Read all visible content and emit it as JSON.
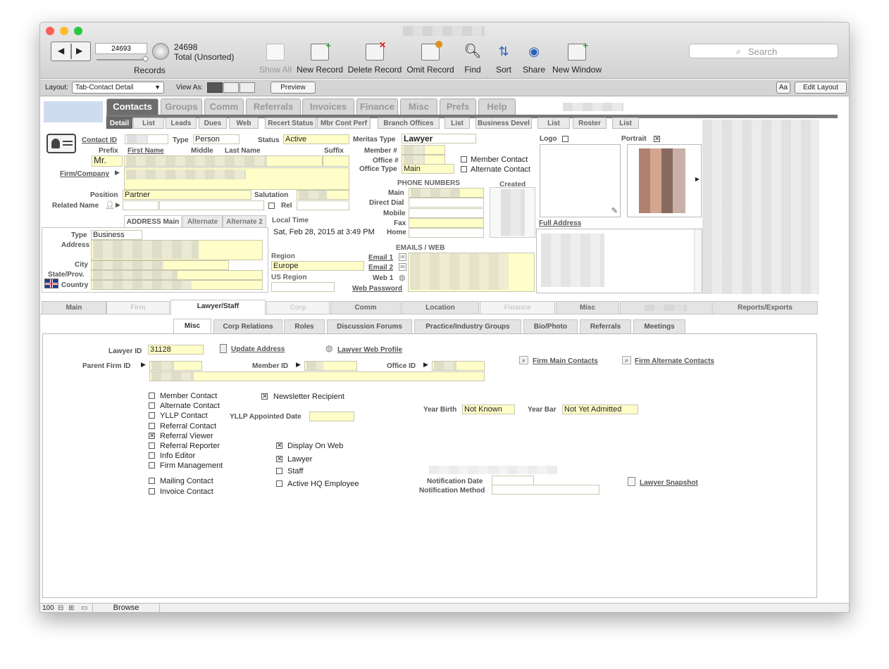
{
  "toolbar": {
    "record_current": "24693",
    "record_count": "24698",
    "record_status": "Total (Unsorted)",
    "records_label": "Records",
    "show_all": "Show All",
    "new_record": "New Record",
    "delete_record": "Delete Record",
    "omit_record": "Omit Record",
    "find": "Find",
    "sort": "Sort",
    "share": "Share",
    "new_window": "New Window",
    "search_placeholder": "Search"
  },
  "layout_bar": {
    "layout_label": "Layout:",
    "layout_value": "Tab-Contact Detail",
    "view_as_label": "View As:",
    "preview": "Preview",
    "font_btn": "Aa",
    "edit_layout": "Edit Layout"
  },
  "main_tabs": [
    "Contacts",
    "Groups",
    "Comm",
    "Referrals",
    "Invoices",
    "Finance",
    "Misc",
    "Prefs",
    "Help"
  ],
  "sub_tabs": [
    "Detail",
    "List",
    "Leads",
    "Dues",
    "Web",
    "Recert Status",
    "Mbr Cont Perf",
    "Branch Offices",
    "List",
    "Business Devel",
    "List",
    "Roster",
    "List"
  ],
  "contact": {
    "contact_id_label": "Contact ID",
    "type_label": "Type",
    "type_value": "Person",
    "status_label": "Status",
    "status_value": "Active",
    "prefix_label": "Prefix",
    "prefix_value": "Mr.",
    "first_name_label": "First Name",
    "middle_label": "Middle",
    "last_name_label": "Last Name",
    "suffix_label": "Suffix",
    "firm_label": "Firm/Company",
    "position_label": "Position",
    "position_value": "Partner",
    "salutation_label": "Salutation",
    "rel_label": "Rel",
    "related_name_label": "Related Name"
  },
  "meritas": {
    "type_label": "Meritas Type",
    "type_value": "Lawyer",
    "member_label": "Member #",
    "office_label": "Office #",
    "office_type_label": "Office Type",
    "office_type_value": "Main",
    "member_contact": "Member Contact",
    "alternate_contact": "Alternate Contact"
  },
  "phones": {
    "header": "PHONE NUMBERS",
    "created": "Created",
    "main": "Main",
    "direct_dial": "Direct Dial",
    "mobile": "Mobile",
    "fax": "Fax",
    "home": "Home"
  },
  "logo_label": "Logo",
  "portrait_label": "Portrait",
  "full_address_label": "Full Address",
  "address": {
    "tabs": [
      "ADDRESS Main",
      "Alternate",
      "Alternate 2"
    ],
    "type_label": "Type",
    "type_value": "Business",
    "address_label": "Address",
    "city_label": "City",
    "state_label": "State/Prov.",
    "country_label": "Country"
  },
  "local_time": {
    "label": "Local Time",
    "value": "Sat, Feb 28, 2015 at 3:49 PM",
    "region_label": "Region",
    "region_value": "Europe",
    "us_region_label": "US Region"
  },
  "emails": {
    "header": "EMAILS / WEB",
    "email1": "Email 1",
    "email2": "Email 2",
    "web1": "Web 1",
    "web_password": "Web Password"
  },
  "bottom_tabs": [
    "Main",
    "Firm",
    "Lawyer/Staff",
    "Corp",
    "Comm",
    "Location",
    "Finance",
    "Misc",
    "Reports/Exports"
  ],
  "staff_tabs": [
    "Misc",
    "Corp Relations",
    "Roles",
    "Discussion Forums",
    "Practice/Industry Groups",
    "Bio/Photo",
    "Referrals",
    "Meetings"
  ],
  "lawyer": {
    "lawyer_id_label": "Lawyer ID",
    "lawyer_id_value": "31128",
    "update_address": "Update Address",
    "web_profile": "Lawyer Web Profile",
    "parent_firm_label": "Parent Firm ID",
    "member_id_label": "Member ID",
    "office_id_label": "Office ID",
    "firm_main_contacts": "Firm Main Contacts",
    "firm_alt_contacts": "Firm Alternate Contacts",
    "yllp_date_label": "YLLP Appointed Date",
    "year_birth_label": "Year Birth",
    "year_birth_value": "Not Known",
    "year_bar_label": "Year Bar",
    "year_bar_value": "Not Yet Admitted",
    "notification_date": "Notification Date",
    "notification_method": "Notification Method",
    "snapshot": "Lawyer Snapshot"
  },
  "checkboxes_left": [
    {
      "label": "Member Contact",
      "checked": false
    },
    {
      "label": "Alternate Contact",
      "checked": false
    },
    {
      "label": "YLLP Contact",
      "checked": false
    },
    {
      "label": "Referral Contact",
      "checked": false
    },
    {
      "label": "Referral Viewer",
      "checked": true
    },
    {
      "label": "Referral Reporter",
      "checked": false
    },
    {
      "label": "Info Editor",
      "checked": false
    },
    {
      "label": "Firm Management",
      "checked": false
    }
  ],
  "checkboxes_mailing": [
    {
      "label": "Mailing Contact",
      "checked": false
    },
    {
      "label": "Invoice Contact",
      "checked": false
    }
  ],
  "newsletter": {
    "label": "Newsletter Recipient",
    "checked": true
  },
  "checkboxes_web": [
    {
      "label": "Display On Web",
      "checked": true
    },
    {
      "label": "Lawyer",
      "checked": true
    },
    {
      "label": "Staff",
      "checked": false
    },
    {
      "label": "Active HQ Employee",
      "checked": false
    }
  ],
  "status_bar": {
    "zoom": "100",
    "mode": "Browse"
  }
}
